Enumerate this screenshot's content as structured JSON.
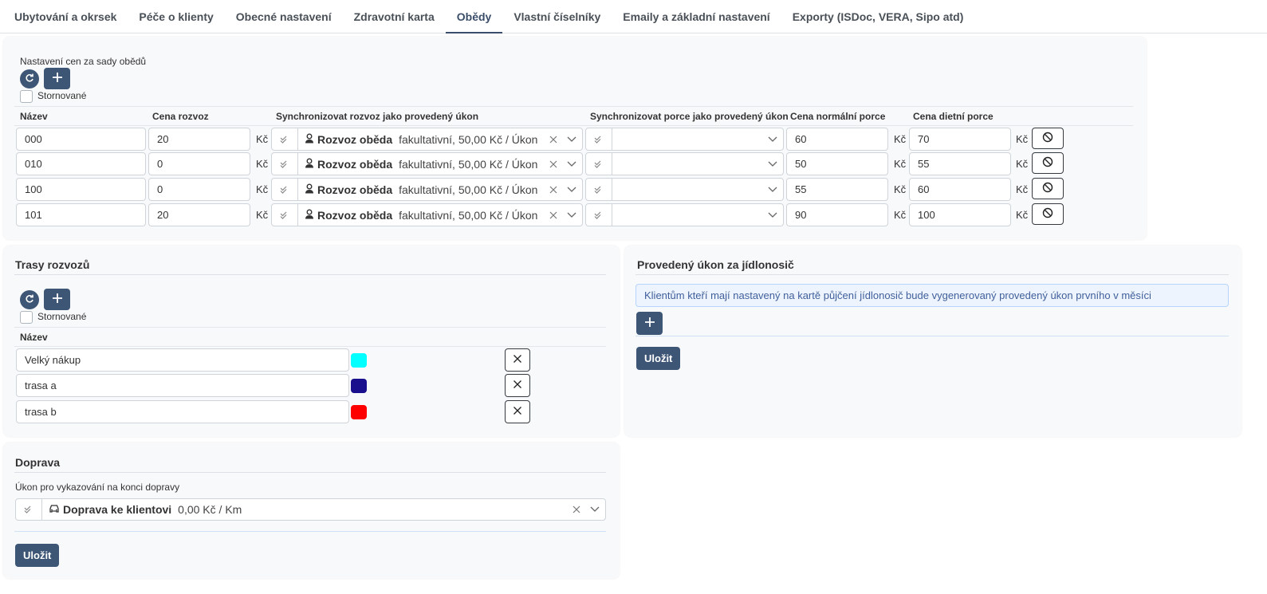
{
  "tabs": [
    {
      "label": "Ubytování a okrsek"
    },
    {
      "label": "Péče o klienty"
    },
    {
      "label": "Obecné nastavení"
    },
    {
      "label": "Zdravotní karta"
    },
    {
      "label": "Obědy"
    },
    {
      "label": "Vlastní číselníky"
    },
    {
      "label": "Emaily a základní nastavení"
    },
    {
      "label": "Exporty (ISDoc, VERA, Sipo atd)"
    }
  ],
  "active_tab": "Obědy",
  "prices": {
    "title": "Nastavení cen za sady obědů",
    "stornovane": "Stornované",
    "headers": {
      "name": "Název",
      "delivery_price": "Cena rozvoz",
      "sync_delivery": "Synchronizovat rozvoz jako provedený úkon",
      "sync_portion": "Synchronizovat porce jako provedený úkon",
      "normal_price": "Cena normální porce",
      "diet_price": "Cena dietní porce"
    },
    "currency": "Kč",
    "service_name": "Rozvoz oběda",
    "service_detail": "fakultativní, 50,00 Kč / Úkon",
    "rows": [
      {
        "name": "000",
        "delivery": "20",
        "normal": "60",
        "diet": "70"
      },
      {
        "name": "010",
        "delivery": "0",
        "normal": "50",
        "diet": "55"
      },
      {
        "name": "100",
        "delivery": "0",
        "normal": "55",
        "diet": "60"
      },
      {
        "name": "101",
        "delivery": "20",
        "normal": "90",
        "diet": "100"
      }
    ]
  },
  "routes": {
    "title": "Trasy rozvozů",
    "stornovane": "Stornované",
    "header_name": "Název",
    "rows": [
      {
        "name": "Velký nákup",
        "color": "#00ffff"
      },
      {
        "name": "trasa a",
        "color": "#1a0f8c"
      },
      {
        "name": "trasa b",
        "color": "#ff0000"
      }
    ]
  },
  "jidlonosic": {
    "title": "Provedený úkon za jídlonosič",
    "info": "Klientům kteří mají nastavený na kartě půjčení jídlonosič bude vygenerovaný provedený úkon prvního v měsíci",
    "save": "Uložit"
  },
  "transport": {
    "title": "Doprava",
    "label": "Úkon pro vykazování na konci dopravy",
    "service_name": "Doprava ke klientovi",
    "service_detail": "0,00 Kč / Km",
    "save": "Uložit"
  },
  "colors": {
    "accent": "#3d5676"
  }
}
